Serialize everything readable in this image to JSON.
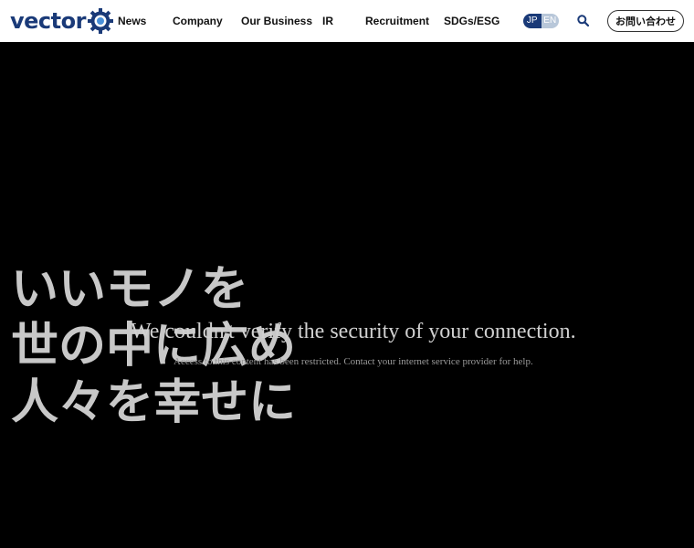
{
  "header": {
    "logo_text": "vector",
    "nav": [
      "News",
      "Company",
      "Our Business",
      "IR",
      "Recruitment",
      "SDGs/ESG"
    ],
    "lang": {
      "jp": "JP",
      "en": "EN"
    },
    "contact_label": "お問い合わせ",
    "colors": {
      "brand": "#1a3a78",
      "lang_inactive": "#b8c7d9"
    }
  },
  "hero": {
    "catch_lines": [
      "いいモノを",
      "世の中に広め",
      "人々を幸せに"
    ],
    "error_title": "We couldn't verify the security of your connection.",
    "error_subtitle": "Access to this content has been restricted. Contact your internet service provider for help."
  }
}
